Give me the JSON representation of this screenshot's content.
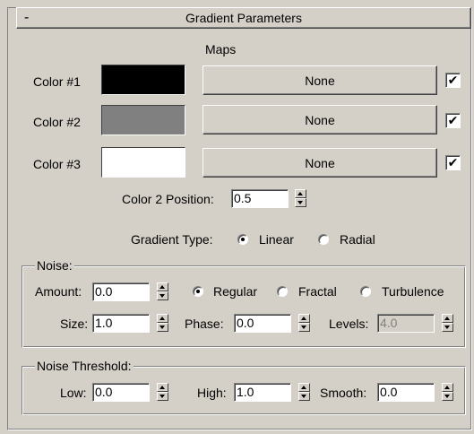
{
  "rollout": {
    "title": "Gradient Parameters",
    "collapse_symbol": "-"
  },
  "maps_label": "Maps",
  "colors": [
    {
      "label": "Color #1",
      "swatch": "#000000",
      "map": "None",
      "checked": "✔"
    },
    {
      "label": "Color #2",
      "swatch": "#808080",
      "map": "None",
      "checked": "✔"
    },
    {
      "label": "Color #3",
      "swatch": "#ffffff",
      "map": "None",
      "checked": "✔"
    }
  ],
  "color2_position": {
    "label": "Color 2 Position:",
    "value": "0.5"
  },
  "gradient_type": {
    "label": "Gradient Type:",
    "options": [
      "Linear",
      "Radial"
    ],
    "selected": "Linear"
  },
  "noise": {
    "group_label": "Noise:",
    "amount_label": "Amount:",
    "amount": "0.0",
    "types": [
      "Regular",
      "Fractal",
      "Turbulence"
    ],
    "selected_type": "Regular",
    "size_label": "Size:",
    "size": "1.0",
    "phase_label": "Phase:",
    "phase": "0.0",
    "levels_label": "Levels:",
    "levels": "4.0"
  },
  "noise_threshold": {
    "group_label": "Noise Threshold:",
    "low_label": "Low:",
    "low": "0.0",
    "high_label": "High:",
    "high": "1.0",
    "smooth_label": "Smooth:",
    "smooth": "0.0"
  },
  "icons": {
    "spinner": "spinner-icon",
    "checkmark": "checkmark-icon",
    "collapse": "collapse-icon"
  },
  "theme": {
    "panel_bg": "#d4d0c8",
    "field_bg": "#ffffff"
  }
}
